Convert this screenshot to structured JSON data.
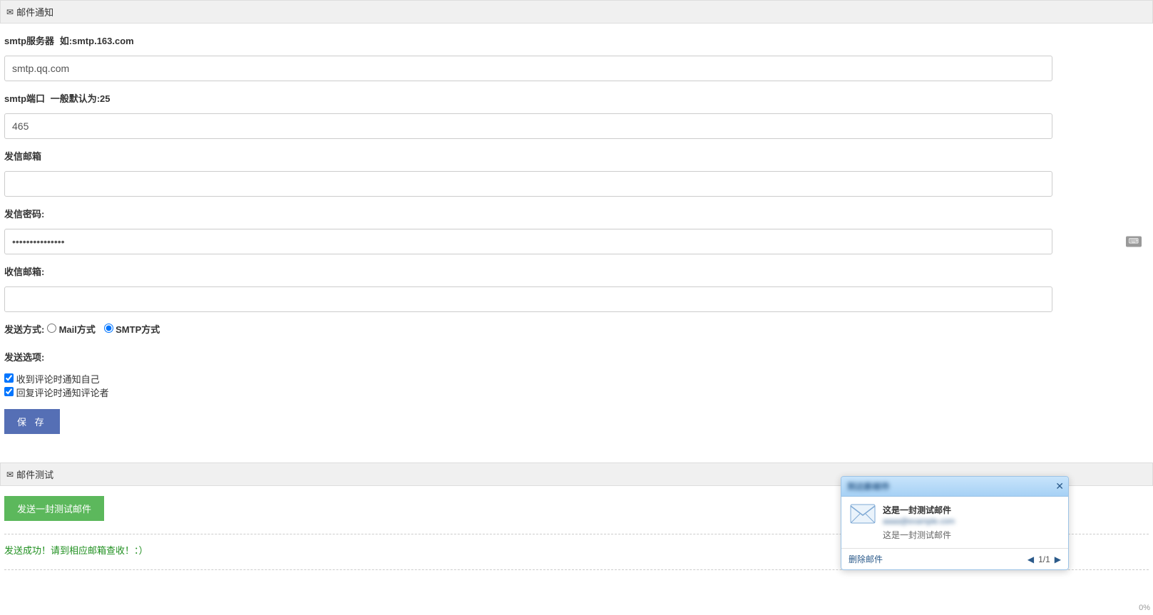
{
  "sections": {
    "notify": {
      "title": "邮件通知"
    },
    "test": {
      "title": "邮件测试"
    }
  },
  "form": {
    "smtp_server": {
      "label": "smtp服务器",
      "hint": "如:smtp.163.com",
      "value": "smtp.qq.com"
    },
    "smtp_port": {
      "label": "smtp端口",
      "hint": "一般默认为:25",
      "value": "465"
    },
    "sender_email": {
      "label": "发信邮箱",
      "value": "                    "
    },
    "sender_password": {
      "label": "发信密码:",
      "value": "•••••••••••••••"
    },
    "receiver_email": {
      "label": "收信邮箱:",
      "value": "                         "
    },
    "send_method": {
      "label": "发送方式:",
      "option_mail": "Mail方式",
      "option_smtp": "SMTP方式"
    },
    "send_options": {
      "label": "发送选项:",
      "opt1": "收到评论时通知自己",
      "opt2": "回复评论时通知评论者"
    },
    "save_label": "保  存"
  },
  "test": {
    "send_test_label": "发送一封测试邮件",
    "success_msg": "发送成功！请到相应邮箱查收！：）"
  },
  "notif": {
    "header_title": "到达新邮件",
    "title": "这是一封测试邮件",
    "sender": "aaaa@example.com",
    "preview": "这是一封测试邮件",
    "delete_label": "删除邮件",
    "page": "1/1"
  },
  "zoom": "0%"
}
